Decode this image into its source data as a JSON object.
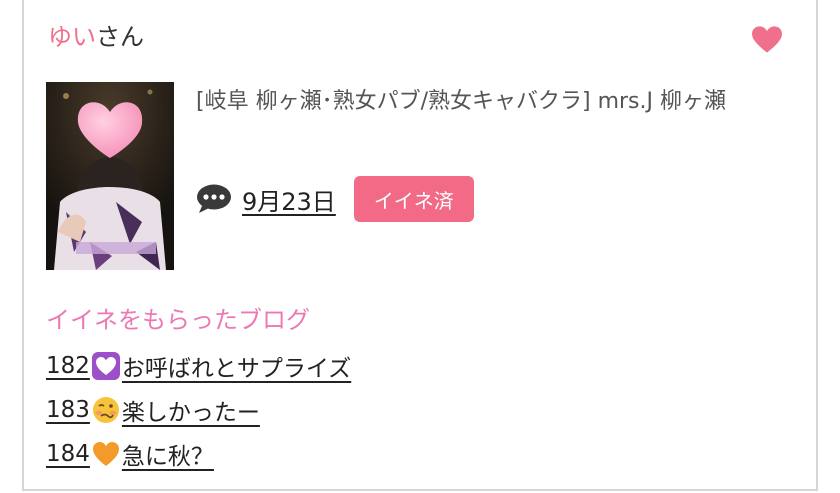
{
  "profile": {
    "name_accent": "ゆい",
    "name_suffix": "さん"
  },
  "shop": {
    "text": "[岐阜 柳ヶ瀬･熟女パブ/熟女キャバクラ]  mrs.J 柳ヶ瀬"
  },
  "meta": {
    "date": "9月23日",
    "iine_label": "イイネ済"
  },
  "section": {
    "title": "イイネをもらったブログ"
  },
  "blogs": [
    {
      "number": "182",
      "emoji": "purple-heart-icon",
      "title": "お呼ばれとサプライズ"
    },
    {
      "number": "183",
      "emoji": "woozy-face-icon",
      "title": "楽しかったー"
    },
    {
      "number": "184",
      "emoji": "orange-heart-icon",
      "title": "急に秋？"
    }
  ],
  "colors": {
    "accent_pink": "#f0708c",
    "button_pink": "#f26a86",
    "section_pink": "#ec79b4",
    "heart_pink": "#f0708c"
  }
}
